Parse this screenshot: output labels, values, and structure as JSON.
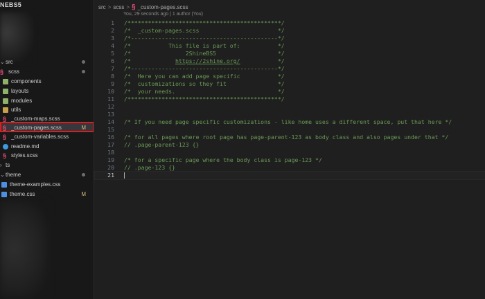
{
  "sidebar": {
    "title": "NEBS5",
    "items": [
      {
        "label": "src",
        "icon": "chevron-down-icon",
        "status": "dot"
      },
      {
        "label": "scss",
        "icon": "sass-folder-icon",
        "status": "dot"
      },
      {
        "label": "components",
        "icon": "folder-icon",
        "status": ""
      },
      {
        "label": "layouts",
        "icon": "folder-icon",
        "status": ""
      },
      {
        "label": "modules",
        "icon": "folder-icon",
        "status": ""
      },
      {
        "label": "utils",
        "icon": "folder-icon",
        "status": ""
      },
      {
        "label": "_custom-maps.scss",
        "icon": "sass-file-icon",
        "status": ""
      },
      {
        "label": "_custom-pages.scss",
        "icon": "sass-file-icon",
        "status": "M"
      },
      {
        "label": "_custom-variables.scss",
        "icon": "sass-file-icon",
        "status": ""
      },
      {
        "label": "readme.md",
        "icon": "info-icon",
        "status": ""
      },
      {
        "label": "styles.scss",
        "icon": "sass-file-icon",
        "status": ""
      },
      {
        "label": "ts",
        "icon": "chevron-right-icon",
        "status": ""
      },
      {
        "label": "theme",
        "icon": "chevron-down-icon",
        "status": "dot"
      },
      {
        "label": "theme-examples.css",
        "icon": "css-file-icon",
        "status": ""
      },
      {
        "label": "theme.css",
        "icon": "css-file-icon",
        "status": "M"
      }
    ]
  },
  "breadcrumb": {
    "parts": [
      "src",
      "scss",
      "_custom-pages.scss"
    ],
    "separator": ">"
  },
  "blame": "You, 29 seconds ago | 1 author (You)",
  "editor": {
    "lines": [
      {
        "n": "1",
        "text": "/*********************************************/"
      },
      {
        "n": "2",
        "text": "/*  _custom-pages.scss                       */"
      },
      {
        "n": "3",
        "text": "/*-------------------------------------------*/"
      },
      {
        "n": "4",
        "text": "/*           This file is part of:           */"
      },
      {
        "n": "5",
        "text": "/*                2ShineBS5                  */"
      },
      {
        "n": "6",
        "text": "/*             https://2shine.org/           */"
      },
      {
        "n": "7",
        "text": "/*-------------------------------------------*/"
      },
      {
        "n": "8",
        "text": "/*  Here you can add page specific           */"
      },
      {
        "n": "9",
        "text": "/*  customizations so they fit               */"
      },
      {
        "n": "10",
        "text": "/*  your needs.                              */"
      },
      {
        "n": "11",
        "text": "/*********************************************/"
      },
      {
        "n": "12",
        "text": ""
      },
      {
        "n": "13",
        "text": ""
      },
      {
        "n": "14",
        "text": "/* If you need page specific customizations - like home uses a different space, put that here */"
      },
      {
        "n": "15",
        "text": ""
      },
      {
        "n": "16",
        "text": "/* for all pages where root page has page-parent-123 as body class and also pages under that */"
      },
      {
        "n": "17",
        "text": "// .page-parent-123 {}"
      },
      {
        "n": "18",
        "text": ""
      },
      {
        "n": "19",
        "text": "/* for a specific page where the body class is page-123 */"
      },
      {
        "n": "20",
        "text": "// .page-123 {}"
      },
      {
        "n": "21",
        "text": ""
      }
    ],
    "active_line": 21
  },
  "colors": {
    "background": "#1f1f1f",
    "sidebar": "#181818",
    "comment": "#6a9955",
    "highlight": "#e01b1b",
    "modified": "#d7ba7d"
  }
}
